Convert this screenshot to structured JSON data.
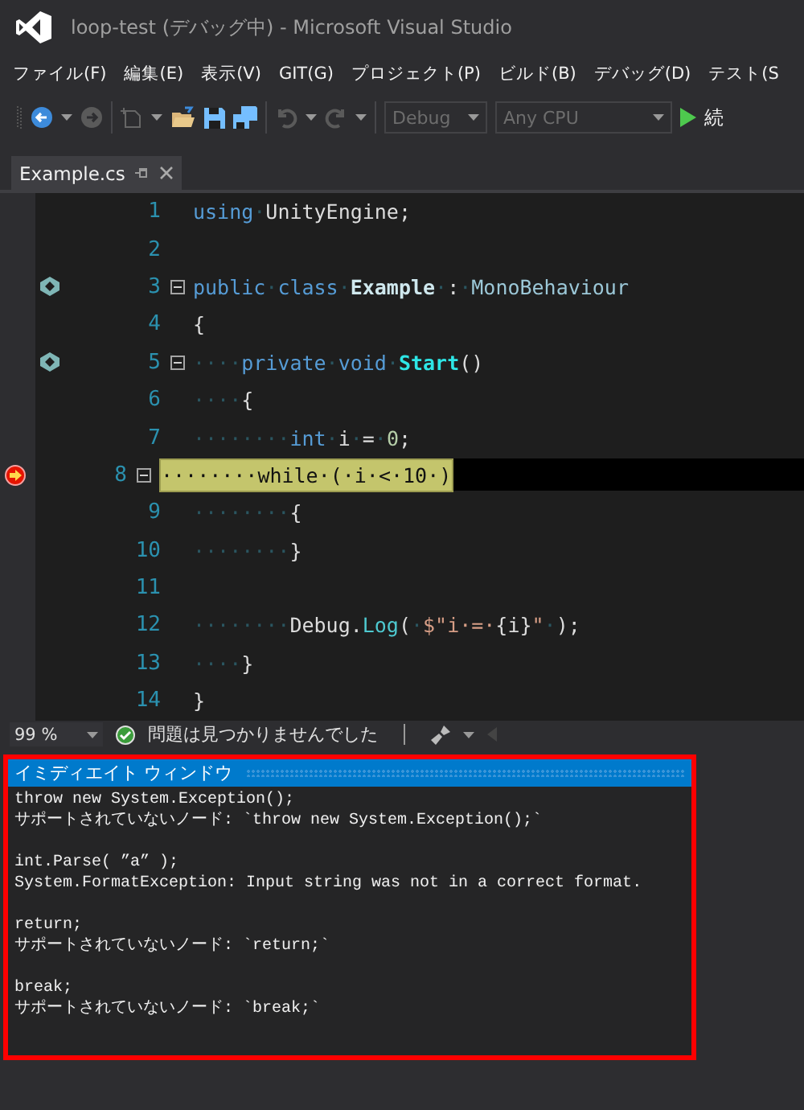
{
  "window": {
    "title": "loop-test (デバッグ中) - Microsoft Visual Studio"
  },
  "menu": [
    "ファイル(F)",
    "編集(E)",
    "表示(V)",
    "GIT(G)",
    "プロジェクト(P)",
    "ビルド(B)",
    "デバッグ(D)",
    "テスト(S"
  ],
  "toolbar": {
    "configuration": {
      "value": "Debug",
      "disabled": true
    },
    "platform": {
      "value": "Any CPU",
      "disabled": true
    },
    "continue_label": "続"
  },
  "tabs": [
    {
      "label": "Example.cs",
      "selected": true
    }
  ],
  "editor": {
    "lines": [
      {
        "number": "1",
        "tokens": [
          {
            "kind": "kw",
            "text": "using"
          },
          {
            "kind": "ws",
            "text": "·"
          },
          {
            "kind": "plain",
            "text": "UnityEngine;"
          }
        ]
      },
      {
        "number": "2"
      },
      {
        "number": "3",
        "glyph": {
          "kind": "unity"
        },
        "foldable": true,
        "tokens": [
          {
            "kind": "kw",
            "text": "public"
          },
          {
            "kind": "ws",
            "text": "·"
          },
          {
            "kind": "kw",
            "text": "class"
          },
          {
            "kind": "ws",
            "text": "·"
          },
          {
            "kind": "class",
            "text": "Example"
          },
          {
            "kind": "ws",
            "text": "·"
          },
          {
            "kind": "plain",
            "text": ":"
          },
          {
            "kind": "ws",
            "text": "·"
          },
          {
            "kind": "type",
            "text": "MonoBehaviour"
          }
        ]
      },
      {
        "number": "4",
        "tokens": [
          {
            "kind": "plain",
            "text": "{"
          }
        ]
      },
      {
        "number": "5",
        "glyph": {
          "kind": "unity"
        },
        "foldable": true,
        "tokens": [
          {
            "kind": "ws",
            "text": "····"
          },
          {
            "kind": "kw",
            "text": "private"
          },
          {
            "kind": "ws",
            "text": "·"
          },
          {
            "kind": "kw",
            "text": "void"
          },
          {
            "kind": "ws",
            "text": "·"
          },
          {
            "kind": "method",
            "text": "Start"
          },
          {
            "kind": "plain",
            "text": "()"
          }
        ]
      },
      {
        "number": "6",
        "tokens": [
          {
            "kind": "ws",
            "text": "····"
          },
          {
            "kind": "plain",
            "text": "{"
          }
        ]
      },
      {
        "number": "7",
        "tokens": [
          {
            "kind": "ws",
            "text": "········"
          },
          {
            "kind": "kw",
            "text": "int"
          },
          {
            "kind": "ws",
            "text": "·"
          },
          {
            "kind": "plain",
            "text": "i"
          },
          {
            "kind": "ws",
            "text": "·"
          },
          {
            "kind": "plain",
            "text": "="
          },
          {
            "kind": "ws",
            "text": "·"
          },
          {
            "kind": "num",
            "text": "0"
          },
          {
            "kind": "plain",
            "text": ";"
          }
        ]
      },
      {
        "number": "8",
        "glyph": {
          "kind": "breakpoint"
        },
        "foldable": true,
        "current": true,
        "text": "········while·(·i·<·10·)"
      },
      {
        "number": "9",
        "tokens": [
          {
            "kind": "ws",
            "text": "········"
          },
          {
            "kind": "plain",
            "text": "{"
          }
        ]
      },
      {
        "number": "10",
        "tokens": [
          {
            "kind": "ws",
            "text": "········"
          },
          {
            "kind": "plain",
            "text": "}"
          }
        ]
      },
      {
        "number": "11"
      },
      {
        "number": "12",
        "tokens": [
          {
            "kind": "ws",
            "text": "········"
          },
          {
            "kind": "plain",
            "text": "Debug."
          },
          {
            "kind": "method2",
            "text": "Log"
          },
          {
            "kind": "plain",
            "text": "("
          },
          {
            "kind": "ws",
            "text": "·"
          },
          {
            "kind": "str",
            "text": "$\"i·=·"
          },
          {
            "kind": "plain",
            "text": "{i}"
          },
          {
            "kind": "str",
            "text": "\""
          },
          {
            "kind": "ws",
            "text": "·"
          },
          {
            "kind": "plain",
            "text": ");"
          }
        ]
      },
      {
        "number": "13",
        "tokens": [
          {
            "kind": "ws",
            "text": "····"
          },
          {
            "kind": "plain",
            "text": "}"
          }
        ]
      },
      {
        "number": "14",
        "tokens": [
          {
            "kind": "plain",
            "text": "}"
          }
        ]
      }
    ]
  },
  "status_bar": {
    "zoom": "99 %",
    "message": "問題は見つかりませんでした"
  },
  "immediate_window": {
    "title": "イミディエイト ウィンドウ",
    "groups": [
      {
        "lines": [
          "throw new System.Exception();",
          "サポートされていないノード: `throw new System.Exception();`"
        ]
      },
      {
        "lines": [
          "int.Parse( ”a” );",
          "System.FormatException: Input string was not in a correct format."
        ]
      },
      {
        "lines": [
          "return;",
          "サポートされていないノード: `return;`"
        ]
      },
      {
        "lines": [
          "break;",
          "サポートされていないノード: `break;`"
        ]
      }
    ]
  }
}
